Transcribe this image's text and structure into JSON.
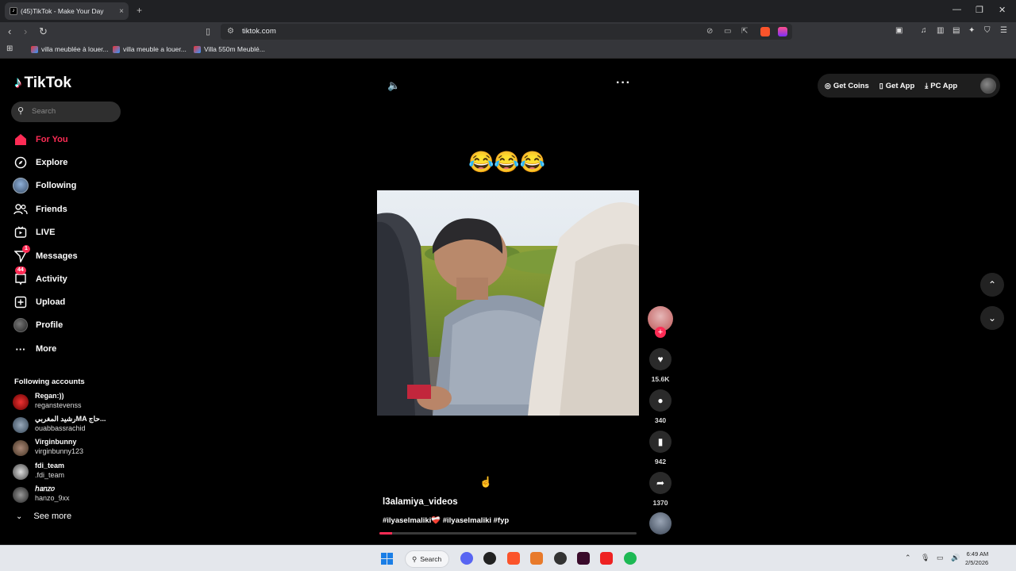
{
  "browser": {
    "tab_title": "(45)TikTok - Make Your Day",
    "tab_close": "×",
    "new_tab": "+",
    "url": "tiktok.com",
    "bookmarks": [
      "villa meublée à louer...",
      "villa meuble a louer...",
      "Villa 550m Meublé..."
    ]
  },
  "sidebar": {
    "logo_text": "TikTok",
    "search_placeholder": "Search",
    "nav": [
      {
        "label": "For You",
        "icon": "home-icon"
      },
      {
        "label": "Explore",
        "icon": "compass-icon"
      },
      {
        "label": "Following",
        "icon": "following-avatar-icon"
      },
      {
        "label": "Friends",
        "icon": "friends-icon"
      },
      {
        "label": "LIVE",
        "icon": "live-tv-icon"
      },
      {
        "label": "Messages",
        "icon": "paper-plane-icon",
        "badge": "1"
      },
      {
        "label": "Activity",
        "icon": "inbox-icon",
        "badge": "44"
      },
      {
        "label": "Upload",
        "icon": "upload-plus-icon"
      },
      {
        "label": "Profile",
        "icon": "profile-avatar-icon"
      },
      {
        "label": "More",
        "icon": "more-dots-icon"
      }
    ],
    "following_title": "Following accounts",
    "accounts": [
      {
        "name": "Regan:))",
        "handle": "reganstevenss"
      },
      {
        "name": "رشيد المغربيMA حاج...",
        "handle": "ouabbassrachid"
      },
      {
        "name": "Virginbunny",
        "handle": "virginbunny123"
      },
      {
        "name": "fdi_team",
        "handle": ".fdi_team"
      },
      {
        "name": "ℎ𝑎𝑛𝑧𝑜",
        "handle": "hanzo_9xx"
      }
    ],
    "see_more": "See more"
  },
  "topbar": {
    "get_coins": "Get Coins",
    "get_app": "Get App",
    "pc_app": "PC App"
  },
  "video": {
    "caption_emojis": "😂😂😂",
    "author": "l3alamiya_videos",
    "tags": "#ilyaselmaliki❤️‍🩹 #ilyaselmaliki #fyp",
    "likes": "15.6K",
    "comments": "340",
    "saves": "942",
    "shares": "1370",
    "progress": 0.05
  },
  "taskbar": {
    "search_label": "Search",
    "time": "6:49 AM",
    "date": "2/5/2026"
  },
  "colors": {
    "accent": "#fe2c55",
    "background": "#000000"
  }
}
